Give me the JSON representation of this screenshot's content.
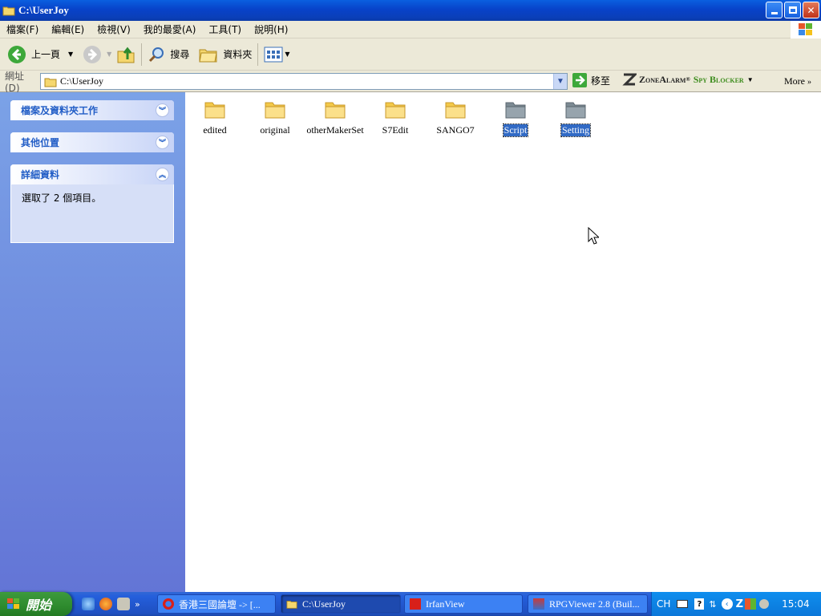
{
  "window": {
    "title": "C:\\UserJoy"
  },
  "menu": [
    "檔案(F)",
    "編輯(E)",
    "檢視(V)",
    "我的最愛(A)",
    "工具(T)",
    "說明(H)"
  ],
  "toolbar": {
    "back": "上一頁",
    "search": "搜尋",
    "folders": "資料夾"
  },
  "address": {
    "label": "網址(D)",
    "value": "C:\\UserJoy",
    "go": "移至"
  },
  "zonealarm": {
    "brand": "ZoneAlarm",
    "product": "Spy Blocker",
    "more": "More"
  },
  "tasks_panel": {
    "file_tasks": "檔案及資料夾工作",
    "other_places": "其他位置",
    "details": "詳細資料",
    "details_text": "選取了 2 個項目。"
  },
  "folders": [
    {
      "name": "edited",
      "selected": false
    },
    {
      "name": "original",
      "selected": false
    },
    {
      "name": "otherMakerSet",
      "selected": false
    },
    {
      "name": "S7Edit",
      "selected": false
    },
    {
      "name": "SANGO7",
      "selected": false
    },
    {
      "name": "Script",
      "selected": true
    },
    {
      "name": "Setting",
      "selected": true
    }
  ],
  "taskbar": {
    "start": "開始",
    "tasks": [
      "香港三國論壇 -> [...",
      "C:\\UserJoy",
      "IrfanView",
      "RPGViewer 2.8 (Buil..."
    ],
    "lang": "CH",
    "clock": "15:04"
  },
  "colors": {
    "titlebar": "#0842c9",
    "selection": "#316ac5",
    "taskbar": "#245edb",
    "start": "#2e8b2e",
    "panel_header": "#215dc6"
  }
}
